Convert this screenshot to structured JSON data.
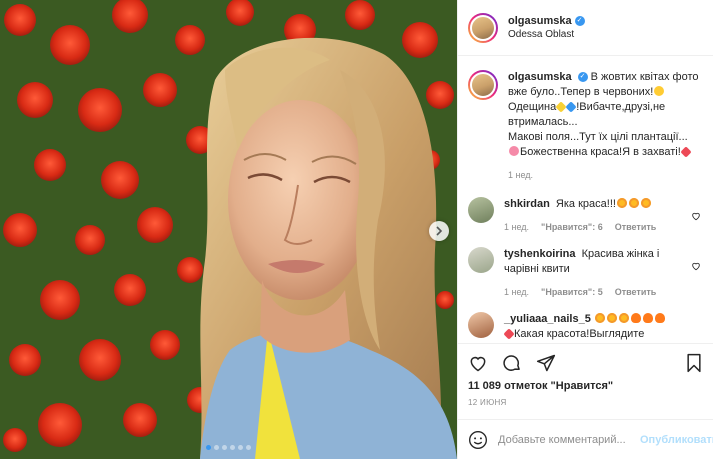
{
  "post": {
    "username": "olgasumska",
    "location": "Odessa Oblast",
    "verified_icon": "verified-badge-icon",
    "carousel": {
      "dot_count": 6,
      "active_index": 0,
      "next_icon": "chevron-right-icon"
    }
  },
  "caption": {
    "username": "olgasumska",
    "line1": "В жовтих квітах фото вже було..Тепер в червоних!",
    "line2a": "Одещина",
    "line2b": "!Вибачте,друзі,не втрималась...",
    "line3": "Макові поля...Тут їх цілі плантації...",
    "line4": "Божественна краса!Я в захваті!",
    "time": "1 нед."
  },
  "comments": [
    {
      "username": "shkirdan",
      "text": "Яка краса!!!",
      "time": "1 нед.",
      "likes": "\"Нравится\": 6",
      "reply": "Ответить"
    },
    {
      "username": "tyshenkoirina",
      "text": "Красива жінка і чарівні квити",
      "time": "1 нед.",
      "likes": "\"Нравится\": 5",
      "reply": "Ответить"
    },
    {
      "username": "_yuliaaa_nails_5",
      "text": "Какая красота!Выглядите",
      "time": "",
      "likes": "",
      "reply": ""
    }
  ],
  "actions": {
    "likes_text": "11 089 отметок \"Нравится\"",
    "date": "12 июня"
  },
  "add_comment": {
    "placeholder": "Добавьте комментарий...",
    "publish_label": "Опубликовать"
  },
  "colors": {
    "accent": "#3897f0",
    "like_red": "#ed4956",
    "publish_disabled": "#b2dffc",
    "muted": "#8e8e8e"
  }
}
